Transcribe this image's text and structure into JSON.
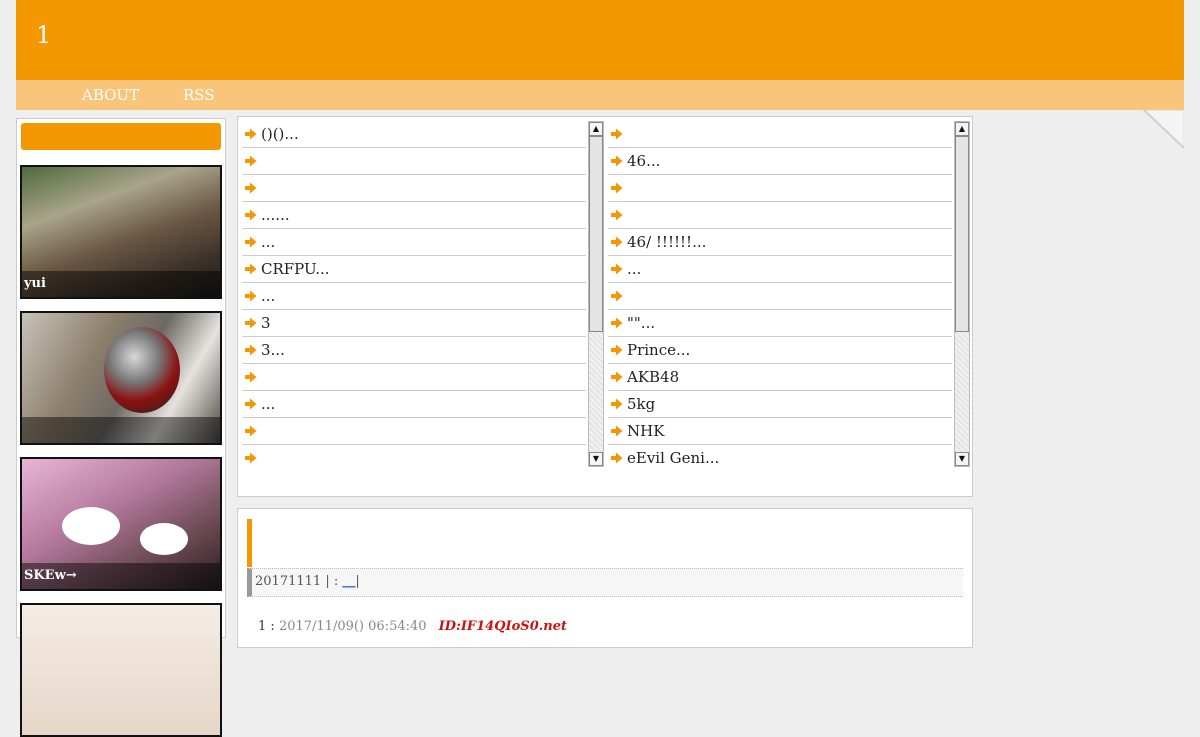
{
  "site": {
    "title": "1"
  },
  "nav": {
    "about": "ABOUT",
    "rss": "RSS"
  },
  "sidebar": {
    "thumbs": [
      {
        "label": "yui"
      },
      {
        "label": ""
      },
      {
        "label": "SKEw→"
      },
      {
        "label": ""
      }
    ]
  },
  "lists": {
    "left": [
      "()()...",
      "",
      "",
      "......",
      "...",
      "CRFPU...",
      "...",
      "3",
      "3...",
      "",
      "...",
      "",
      ""
    ],
    "right": [
      "",
      "46...",
      "",
      "",
      "46/                              !!!!!!...",
      "...",
      "",
      "\"\"...",
      "Prince...",
      "AKB48",
      "5kg",
      " NHK",
      "eEvil Geni..."
    ]
  },
  "post": {
    "meta_prefix": "20171111",
    "meta_sep1": "|",
    "meta_colon": ":",
    "meta_link": "__",
    "meta_sep2": "|",
    "line_num": "1 :",
    "line_date": "2017/11/09() 06:54:40",
    "line_id": "ID:IF14QIoS0.net"
  },
  "colors": {
    "accent": "#f39800",
    "nav": "#f8c57a",
    "id": "#cc1111"
  }
}
